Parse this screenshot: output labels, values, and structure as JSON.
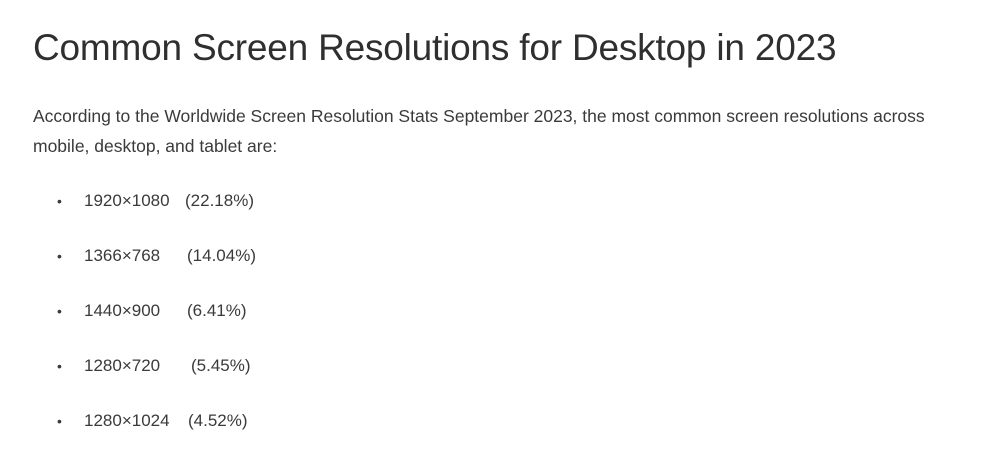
{
  "article": {
    "title": "Common Screen Resolutions for Desktop in 2023",
    "intro": "According to the Worldwide Screen Resolution Stats September 2023, the most common screen resolutions across mobile, desktop, and tablet are:",
    "bullet_glyph": "•",
    "resolutions": [
      {
        "value": "1920×1080",
        "share": "(22.18%)"
      },
      {
        "value": "1366×768",
        "share": "(14.04%)"
      },
      {
        "value": "1440×900",
        "share": "(6.41%)"
      },
      {
        "value": "1280×720",
        "share": "(5.45%)"
      },
      {
        "value": "1280×1024",
        "share": "(4.52%)"
      }
    ]
  }
}
